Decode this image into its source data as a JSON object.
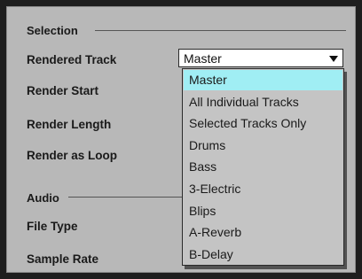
{
  "sections": {
    "selection": "Selection",
    "audio": "Audio"
  },
  "labels": {
    "rendered_track": "Rendered Track",
    "render_start": "Render Start",
    "render_length": "Render Length",
    "render_as_loop": "Render as Loop",
    "file_type": "File Type",
    "sample_rate": "Sample Rate"
  },
  "rendered_track_select": {
    "value": "Master",
    "options": [
      "Master",
      "All Individual Tracks",
      "Selected Tracks Only",
      "Drums",
      "Bass",
      "3-Electric",
      "Blips",
      "A-Reverb",
      "B-Delay"
    ],
    "highlighted_index": 0
  },
  "colors": {
    "panel_bg": "#b8b8b8",
    "highlight": "#a0eef4"
  }
}
